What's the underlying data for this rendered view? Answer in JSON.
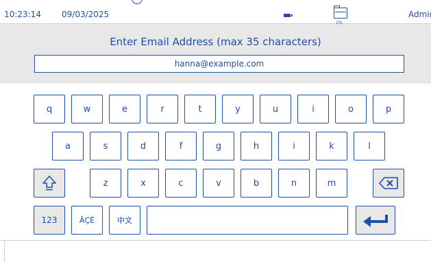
{
  "status_bar": {
    "time": "10:23:14",
    "date": "09/03/2025",
    "storage_percent": "1%",
    "user": "Admin"
  },
  "entry": {
    "title": "Enter Email Address (max 35 characters)",
    "value": "hanna@example.com"
  },
  "keyboard": {
    "row1": [
      "q",
      "w",
      "e",
      "r",
      "t",
      "y",
      "u",
      "i",
      "o",
      "p"
    ],
    "row2": [
      "a",
      "s",
      "d",
      "f",
      "g",
      "h",
      "i",
      "k",
      "l"
    ],
    "row3": [
      "z",
      "x",
      "c",
      "v",
      "b",
      "n",
      "m"
    ],
    "numbers_label": "123",
    "accents_label": "ĂÇÉ",
    "chinese_label": "中文"
  },
  "icons": {
    "shift": "shift-arrow-icon",
    "backspace": "backspace-icon",
    "enter": "enter-arrow-icon",
    "battery": "battery-icon",
    "storage": "storage-icon"
  },
  "colors": {
    "accent": "#1f4fa8",
    "panel": "#e8e8e8"
  }
}
